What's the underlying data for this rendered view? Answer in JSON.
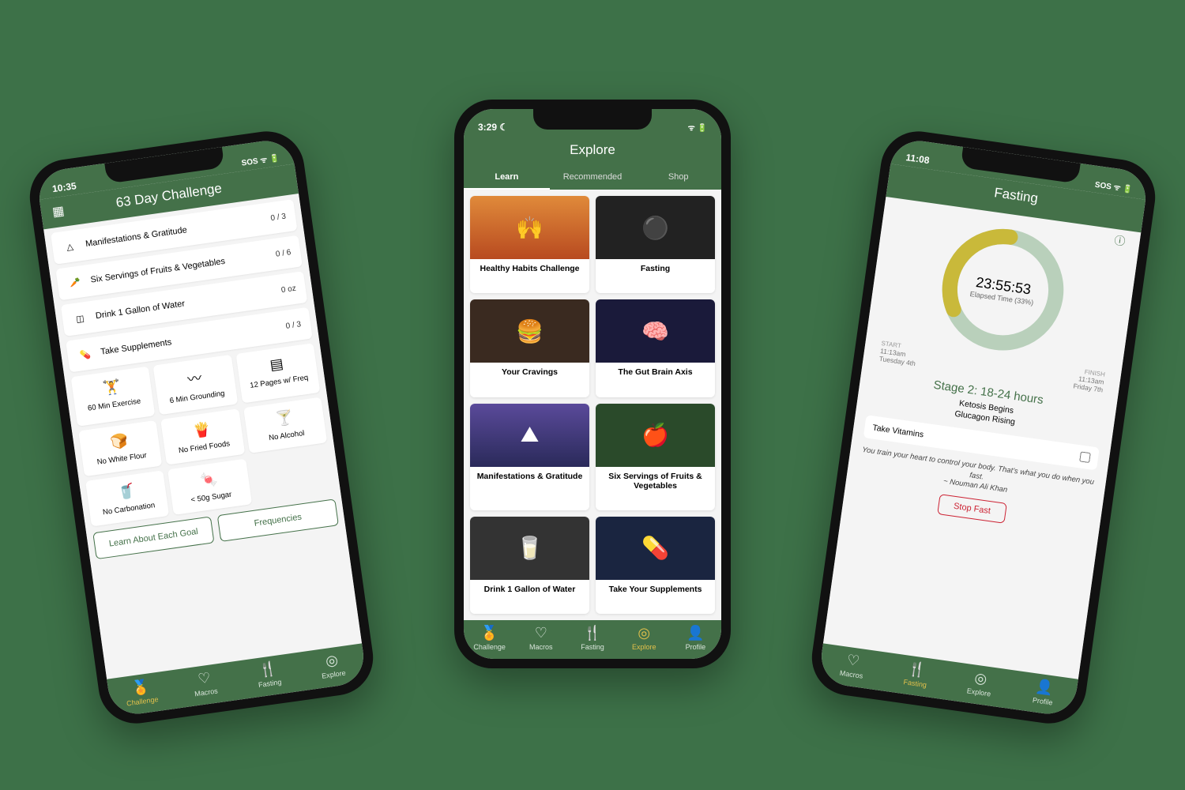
{
  "phone_left": {
    "status_time": "10:35",
    "status_right": "SOS  ᯤ  🔋",
    "title": "63 Day Challenge",
    "rows": [
      {
        "icon": "△",
        "label": "Manifestations & Gratitude",
        "count": "0 / 3"
      },
      {
        "icon": "🥕",
        "label": "Six Servings of Fruits & Vegetables",
        "count": "0 / 6"
      },
      {
        "icon": "◫",
        "label": "Drink 1 Gallon of Water",
        "count": "0 oz"
      },
      {
        "icon": "💊",
        "label": "Take Supplements",
        "count": "0 / 3"
      }
    ],
    "tiles": [
      {
        "icon": "🏋",
        "label": "60 Min Exercise"
      },
      {
        "icon": "〰",
        "label": "6 Min Grounding"
      },
      {
        "icon": "▤",
        "label": "12 Pages w/ Freq"
      },
      {
        "icon": "🍞",
        "label": "No White Flour"
      },
      {
        "icon": "🍟",
        "label": "No Fried Foods"
      },
      {
        "icon": "🍸",
        "label": "No Alcohol"
      },
      {
        "icon": "🥤",
        "label": "No Carbonation"
      },
      {
        "icon": "🍬",
        "label": "< 50g Sugar"
      }
    ],
    "actions": [
      "Learn About Each Goal",
      "Frequencies"
    ],
    "tabbar": [
      {
        "icon": "🏅",
        "label": "Challenge",
        "active": true
      },
      {
        "icon": "♡",
        "label": "Macros"
      },
      {
        "icon": "🍴",
        "label": "Fasting"
      },
      {
        "icon": "◎",
        "label": "Explore"
      }
    ]
  },
  "phone_center": {
    "status_time": "3:29 ☾",
    "status_right": "ᯤ  🔋",
    "title": "Explore",
    "tabs": [
      "Learn",
      "Recommended",
      "Shop"
    ],
    "cards": [
      {
        "title": "Healthy Habits Challenge",
        "cls": "c1",
        "emoji": "🙌"
      },
      {
        "title": "Fasting",
        "cls": "c2",
        "emoji": "⚫"
      },
      {
        "title": "Your Cravings",
        "cls": "c3",
        "emoji": "🍔"
      },
      {
        "title": "The Gut Brain Axis",
        "cls": "c4",
        "emoji": "🧠"
      },
      {
        "title": "Manifestations & Gratitude",
        "cls": "c5",
        "emoji": "⛰"
      },
      {
        "title": "Six Servings of Fruits & Vegetables",
        "cls": "c6",
        "emoji": "🍎"
      },
      {
        "title": "Drink 1 Gallon of Water",
        "cls": "c7",
        "emoji": "🥛"
      },
      {
        "title": "Take Your Supplements",
        "cls": "c8",
        "emoji": "💊"
      }
    ],
    "tabbar": [
      {
        "icon": "🏅",
        "label": "Challenge"
      },
      {
        "icon": "♡",
        "label": "Macros"
      },
      {
        "icon": "🍴",
        "label": "Fasting"
      },
      {
        "icon": "◎",
        "label": "Explore",
        "active": true
      },
      {
        "icon": "👤",
        "label": "Profile"
      }
    ]
  },
  "phone_right": {
    "status_time": "11:08",
    "status_right": "SOS  ᯤ  🔋",
    "title": "Fasting",
    "timer": "23:55:53",
    "elapsed": "Elapsed Time (33%)",
    "start": {
      "label": "START",
      "time": "11:13am",
      "day": "Tuesday 4th"
    },
    "finish": {
      "label": "FINISH",
      "time": "11:13am",
      "day": "Friday 7th"
    },
    "stage": "Stage 2: 18-24 hours",
    "stage_sub1": "Ketosis Begins",
    "stage_sub2": "Glucagon Rising",
    "task": "Take Vitamins",
    "quote": "You train your heart to control your body. That's what you do when you fast.",
    "quote_author": "~ Nouman Ali Khan",
    "stop": "Stop Fast",
    "tabbar": [
      {
        "icon": "♡",
        "label": "Macros"
      },
      {
        "icon": "🍴",
        "label": "Fasting",
        "active": true
      },
      {
        "icon": "◎",
        "label": "Explore"
      },
      {
        "icon": "👤",
        "label": "Profile"
      }
    ]
  }
}
